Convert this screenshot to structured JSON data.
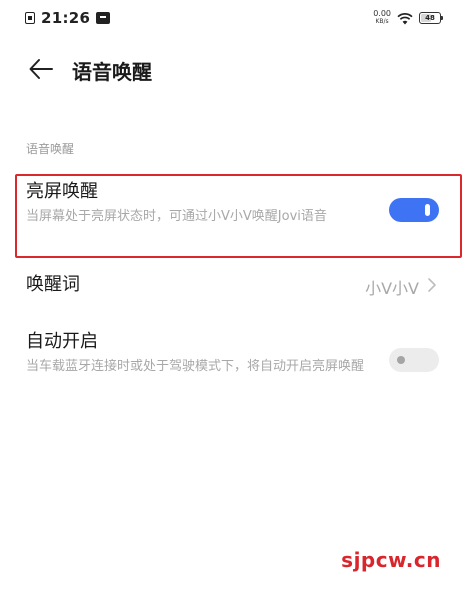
{
  "status_bar": {
    "time": "21:26",
    "net_speed_value": "0.00",
    "net_speed_unit": "KB/s",
    "battery_level": "48",
    "battery_fraction": 0.48,
    "icons": [
      "sim-icon",
      "message-icon",
      "wifi-icon",
      "battery-icon"
    ]
  },
  "header": {
    "back_icon": "arrow-left-icon",
    "title": "语音唤醒"
  },
  "section": {
    "label": "语音唤醒"
  },
  "settings": {
    "screen_wake": {
      "title": "亮屏唤醒",
      "description": "当屏幕处于亮屏状态时，可通过小V小V唤醒Jovi语音",
      "enabled": true
    },
    "wake_word": {
      "title": "唤醒词",
      "value": "小V小V",
      "chevron_icon": "chevron-right-icon"
    },
    "auto_start": {
      "title": "自动开启",
      "description": "当车载蓝牙连接时或处于驾驶模式下，将自动开启亮屏唤醒",
      "enabled": false
    }
  },
  "watermark": "sjpcw.cn",
  "colors": {
    "accent": "#3e74f4",
    "highlight_border": "#d9292c",
    "watermark": "#d8262c",
    "secondary_text": "#a8a8a8"
  }
}
